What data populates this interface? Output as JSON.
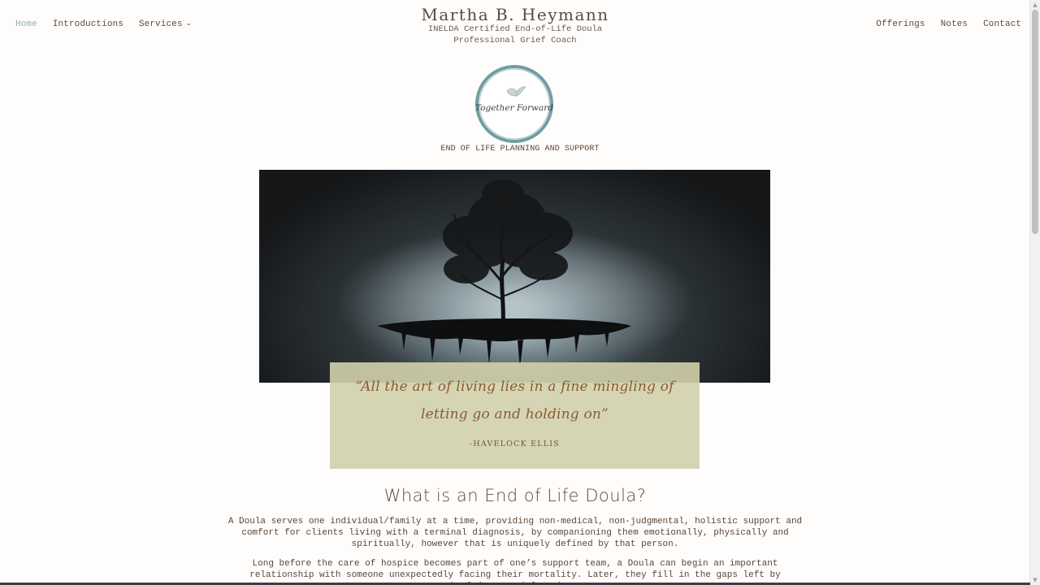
{
  "nav": {
    "left": [
      {
        "label": "Home",
        "active": true
      },
      {
        "label": "Introductions"
      },
      {
        "label": "Services",
        "has_dropdown": true
      }
    ],
    "right": [
      {
        "label": "Offerings"
      },
      {
        "label": "Notes"
      },
      {
        "label": "Contact"
      }
    ]
  },
  "brand": {
    "title": "Martha B. Heymann",
    "subtitle_1": "INELDA Certified End-of-Life Doula",
    "subtitle_2": "Professional Grief Coach"
  },
  "logo": {
    "script_text": "Together Forward",
    "tagline": "END OF LIFE PLANNING AND SUPPORT",
    "ring_color": "#6f9ea1"
  },
  "hero": {
    "quote": "“All the art of living lies in a fine mingling of letting go and holding on”",
    "attribution": "-HAVELOCK ELLIS"
  },
  "section": {
    "title": "What is an End of Life Doula?",
    "paragraph_1": "A Doula serves one individual/family at a time, providing non-medical, non-judgmental, holistic support and comfort for clients living with a terminal diagnosis, by companioning them emotionally, physically and spiritually, however that is uniquely defined by that person.",
    "paragraph_2": "Long before the care of hospice becomes part of one’s support team, a Doula can begin an important relationship with someone unexpectedly facing their mortality. Later, they fill in the gaps left by chaplains, social workers,"
  },
  "colors": {
    "accent": "#93b3ad",
    "quote_bg": "#d2d0ab",
    "quote_text": "#8a5a36",
    "text": "#5b4536"
  }
}
